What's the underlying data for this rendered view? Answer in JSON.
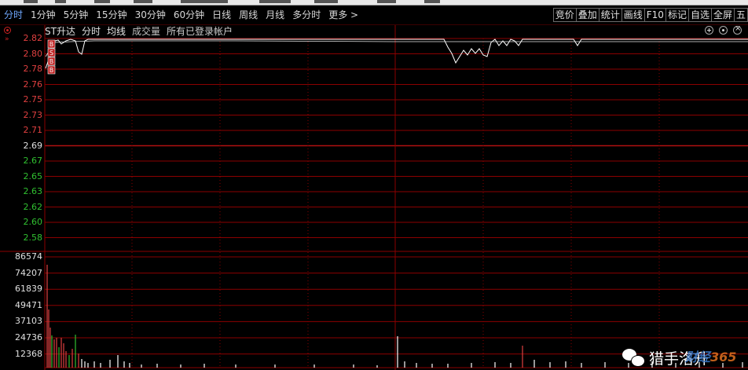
{
  "toolbar": {
    "periods": [
      "分时",
      "1分钟",
      "5分钟",
      "15分钟",
      "30分钟",
      "60分钟",
      "日线",
      "周线",
      "月线",
      "多分时",
      "更多 >"
    ],
    "active_period": "分时",
    "right_buttons": [
      "竞价",
      "叠加",
      "统计",
      "画线",
      "F10",
      "标记",
      "自选",
      "全屏",
      "五"
    ]
  },
  "chart_info": {
    "stock_name": "ST升达",
    "mode": "分时",
    "avg_line": "均线",
    "volume": "成交量",
    "note": "所有已登录帐户"
  },
  "price_axis": [
    {
      "label": "2.82",
      "color": "red"
    },
    {
      "label": "2.80",
      "color": "red"
    },
    {
      "label": "2.78",
      "color": "red"
    },
    {
      "label": "2.76",
      "color": "red"
    },
    {
      "label": "2.75",
      "color": "red"
    },
    {
      "label": "2.73",
      "color": "red"
    },
    {
      "label": "2.71",
      "color": "red"
    },
    {
      "label": "2.69",
      "color": "white"
    },
    {
      "label": "2.67",
      "color": "green"
    },
    {
      "label": "2.65",
      "color": "green"
    },
    {
      "label": "2.63",
      "color": "green"
    },
    {
      "label": "2.62",
      "color": "green"
    },
    {
      "label": "2.60",
      "color": "green"
    },
    {
      "label": "2.58",
      "color": "green"
    }
  ],
  "volume_axis": [
    "86574",
    "74207",
    "61839",
    "49471",
    "37103",
    "24736",
    "12368"
  ],
  "badges": [
    "B",
    "S",
    "B",
    "B"
  ],
  "watermark": {
    "text": "猎手洛升",
    "logo_part1": "财经",
    "logo_part2": "365"
  },
  "colors": {
    "grid": "#8b0000",
    "up": "#e04040",
    "down": "#30c030",
    "price_line": "#ffffff",
    "active_tab": "#6fa8ff"
  }
}
